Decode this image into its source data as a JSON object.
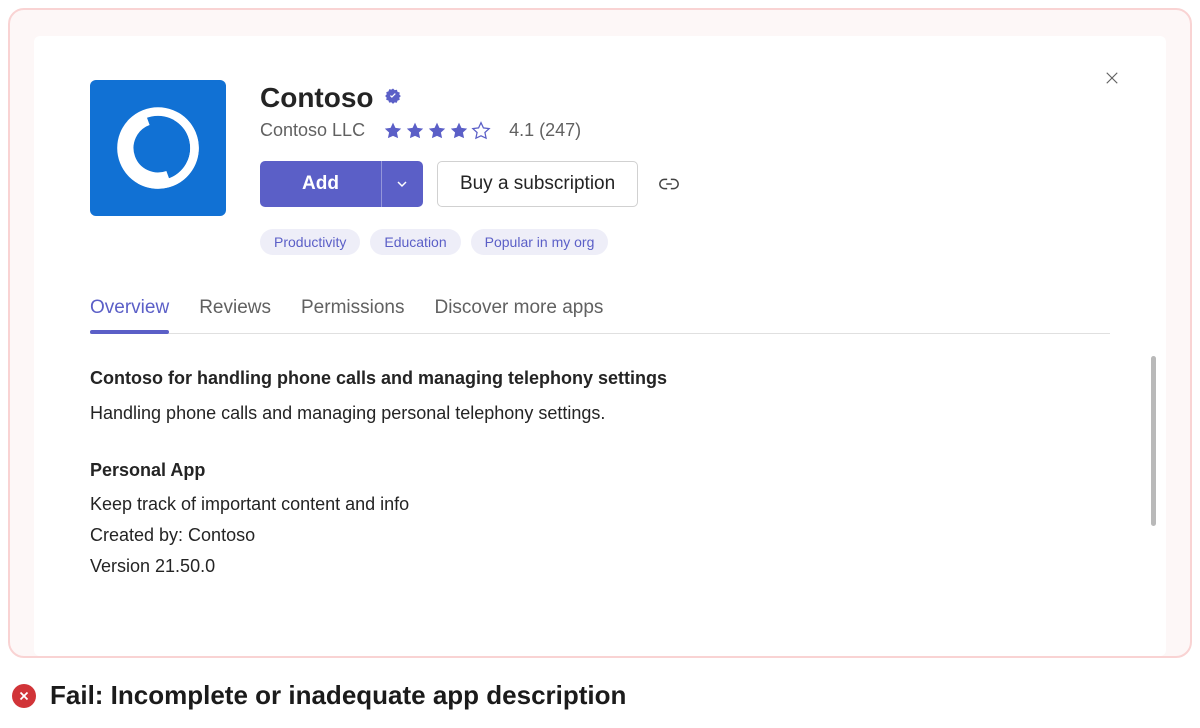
{
  "app": {
    "title": "Contoso",
    "publisher": "Contoso LLC",
    "rating_value": "4.1",
    "rating_count": "247",
    "rating_text": "4.1 (247)",
    "stars_full": 4,
    "stars_empty": 1
  },
  "actions": {
    "add_label": "Add",
    "buy_label": "Buy a subscription"
  },
  "tags": [
    "Productivity",
    "Education",
    "Popular in my org"
  ],
  "tabs": [
    {
      "label": "Overview",
      "active": true
    },
    {
      "label": "Reviews",
      "active": false
    },
    {
      "label": "Permissions",
      "active": false
    },
    {
      "label": "Discover more apps",
      "active": false
    }
  ],
  "overview": {
    "headline": "Contoso for handling phone calls and managing telephony settings",
    "summary": "Handling phone calls and managing personal telephony settings.",
    "section_title": "Personal App",
    "section_line1": "Keep track of important content and info",
    "created_by_line": "Created by: Contoso",
    "version_line": "Version 21.50.0"
  },
  "fail": {
    "label": "Fail: Incomplete or inadequate app description"
  },
  "colors": {
    "primary": "#5b5fc7",
    "icon_bg": "#1171d4",
    "error": "#d13438",
    "frame_border": "#f9d3d3"
  }
}
